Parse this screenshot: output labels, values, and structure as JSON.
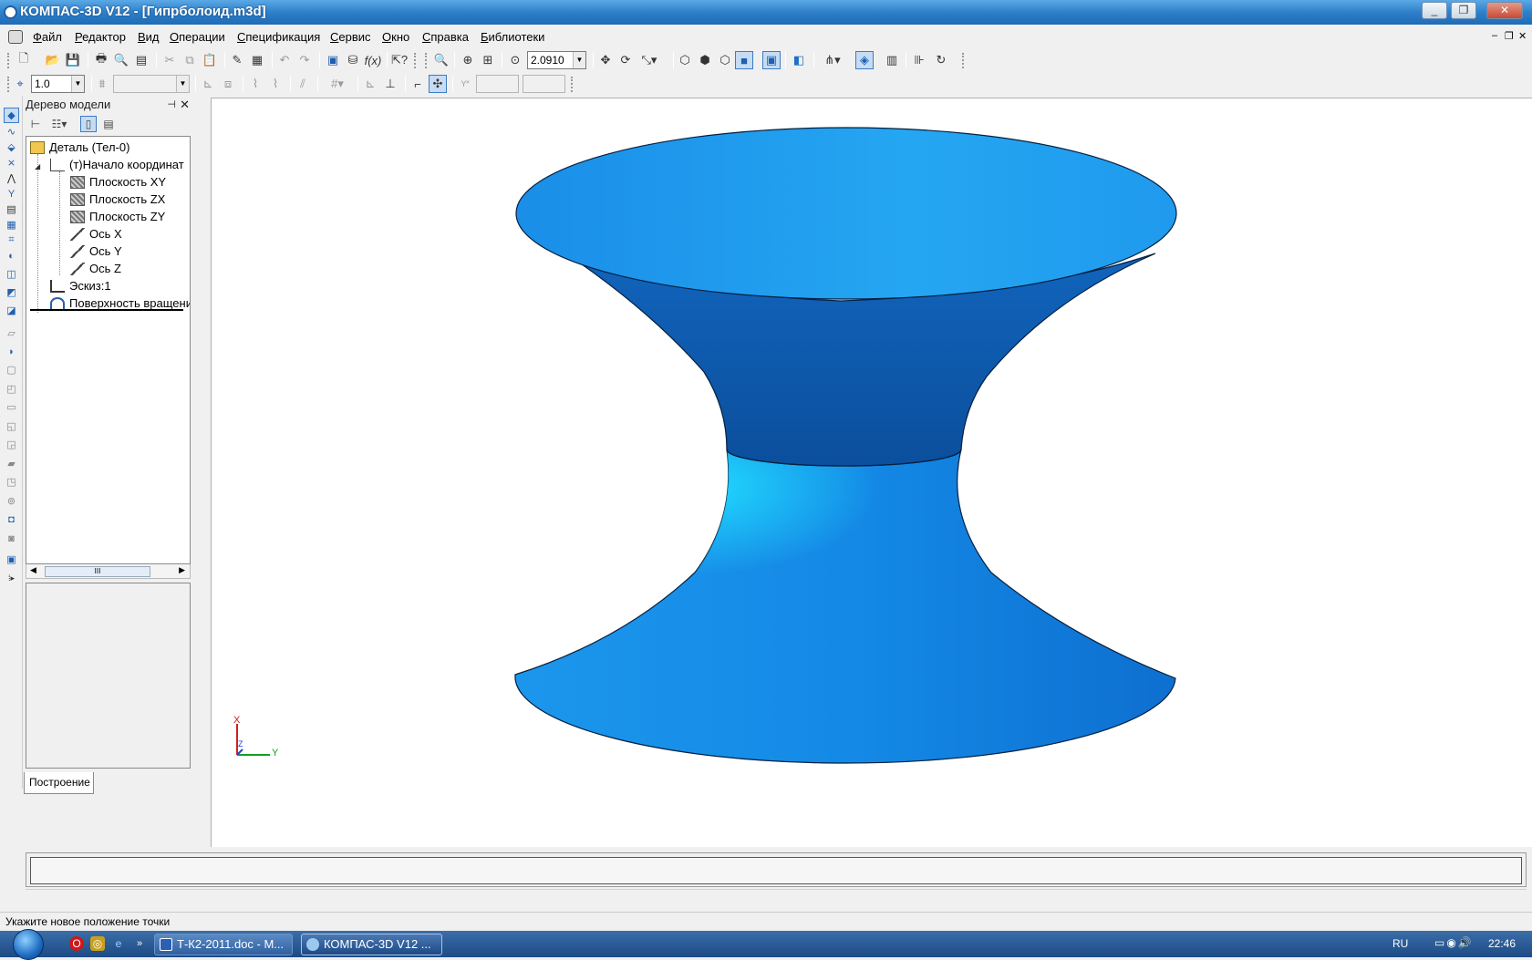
{
  "window": {
    "title": "КОМПАС-3D V12 - [Гипрболоид.m3d]",
    "minimize_glyph": "_",
    "restore_glyph": "❐",
    "close_glyph": "✕"
  },
  "menu": {
    "items": [
      "Файл",
      "Редактор",
      "Вид",
      "Операции",
      "Спецификация",
      "Сервис",
      "Окно",
      "Справка",
      "Библиотеки"
    ],
    "underlines": [
      "Ф",
      "Р",
      "В",
      "О",
      "С",
      "С",
      "О",
      "С",
      "Б"
    ],
    "mdi_controls": [
      "‒",
      "❐",
      "✕"
    ]
  },
  "toolbar_main": {
    "zoom_value": "2.0910"
  },
  "toolbar_second": {
    "step_value": "1.0",
    "layer_value": "",
    "coord_x": "",
    "coord_y": ""
  },
  "tree_panel": {
    "title": "Дерево модели",
    "pin_glyph": "⊣",
    "close_glyph": "✕",
    "nodes": [
      {
        "label": "Деталь (Тел-0)",
        "icon": "part-icon"
      },
      {
        "label": "(т)Начало координат",
        "icon": "origin-icon"
      },
      {
        "label": "Плоскость XY",
        "icon": "plane-icon"
      },
      {
        "label": "Плоскость ZX",
        "icon": "plane-icon"
      },
      {
        "label": "Плоскость ZY",
        "icon": "plane-icon"
      },
      {
        "label": "Ось X",
        "icon": "axis-icon"
      },
      {
        "label": "Ось Y",
        "icon": "axis-icon"
      },
      {
        "label": "Ось Z",
        "icon": "axis-icon"
      },
      {
        "label": "Эскиз:1",
        "icon": "sketch-icon"
      },
      {
        "label": "Поверхность вращения",
        "icon": "surface-icon"
      }
    ],
    "scroll_thumb_glyph": "III",
    "tab_label": "Построение"
  },
  "viewport": {
    "surface_color": "#1a8fe6",
    "axis_labels": {
      "x": "X",
      "y": "Y",
      "z": "Z"
    }
  },
  "status": {
    "hint": "Укажите новое положение точки"
  },
  "taskbar": {
    "quick_launch": [
      "opera-icon",
      "app-icon",
      "ie-icon"
    ],
    "overflow_glyph": "»",
    "tasks": [
      {
        "label": "Т-К2-2011.doc - M...",
        "active": false
      },
      {
        "label": "КОМПАС-3D V12 ...",
        "active": true
      }
    ],
    "language": "RU",
    "clock": "22:46"
  }
}
